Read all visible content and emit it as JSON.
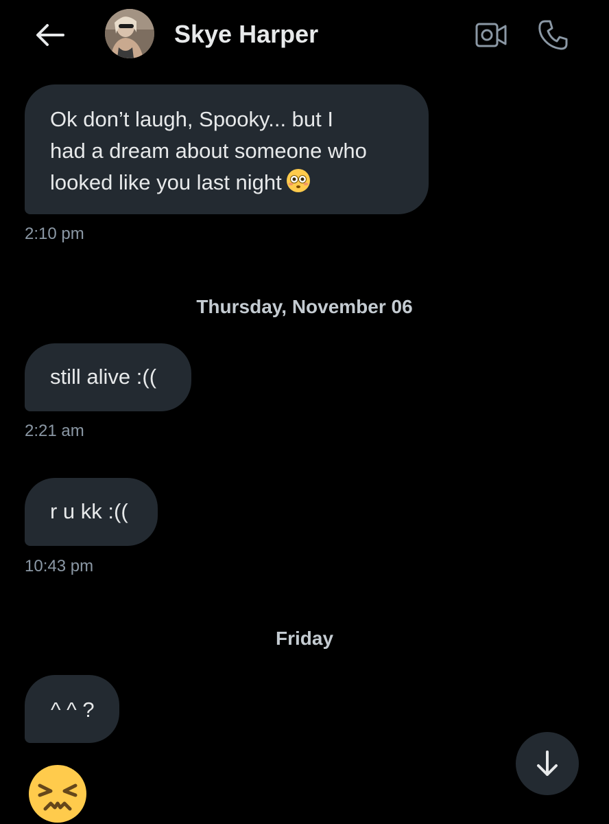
{
  "header": {
    "contact_name": "Skye Harper",
    "back_icon": "arrow-left-icon",
    "video_icon": "video-camera-icon",
    "call_icon": "phone-icon"
  },
  "messages": [
    {
      "lines": [
        "Ok don’t laugh, Spooky... but I",
        "had a dream about someone who",
        "looked like you last night"
      ],
      "trailing_emoji": "flushed-face-emoji",
      "time": "2:10 pm"
    },
    {
      "lines": [
        "still alive :(("
      ],
      "time": "2:21 am"
    },
    {
      "lines": [
        "r u kk :(("
      ],
      "time": "10:43 pm"
    },
    {
      "lines": [
        "^ ^ ?"
      ]
    }
  ],
  "date_separators": [
    "Thursday, November 06",
    "Friday"
  ],
  "reaction_emoji": "persevering-face-emoji",
  "scroll_button_icon": "arrow-down-icon",
  "colors": {
    "background": "#000000",
    "bubble": "#232a31",
    "text": "#e7e9ea",
    "timestamp": "#8b98a5",
    "emoji_yellow": "#ffcb4c"
  }
}
